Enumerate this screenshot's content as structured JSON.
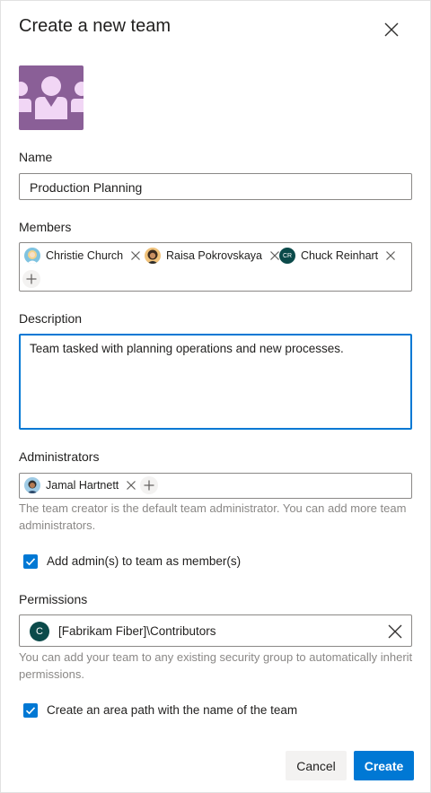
{
  "dialog": {
    "title": "Create a new team"
  },
  "name": {
    "label": "Name",
    "value": "Production Planning"
  },
  "members": {
    "label": "Members",
    "people": [
      {
        "name": "Christie Church",
        "initials": ""
      },
      {
        "name": "Raisa Pokrovskaya",
        "initials": ""
      },
      {
        "name": "Chuck Reinhart",
        "initials": "CR"
      }
    ]
  },
  "description": {
    "label": "Description",
    "value": "Team tasked with planning operations and new processes."
  },
  "administrators": {
    "label": "Administrators",
    "people": [
      {
        "name": "Jamal Hartnett"
      }
    ],
    "helper": "The team creator is the default team administrator. You can add more team administrators."
  },
  "add_admins_checkbox": {
    "label": "Add admin(s) to team as member(s)",
    "checked": true
  },
  "permissions": {
    "label": "Permissions",
    "value": "[Fabrikam Fiber]\\Contributors",
    "initial": "C",
    "helper": "You can add your team to any existing security group to automatically inherit permissions."
  },
  "area_path_checkbox": {
    "label": "Create an area path with the name of the team",
    "checked": true
  },
  "buttons": {
    "cancel": "Cancel",
    "create": "Create"
  },
  "colors": {
    "accent": "#0078d4",
    "team_image": "#8a5f97",
    "avatar_dark": "#0b4a4a"
  }
}
